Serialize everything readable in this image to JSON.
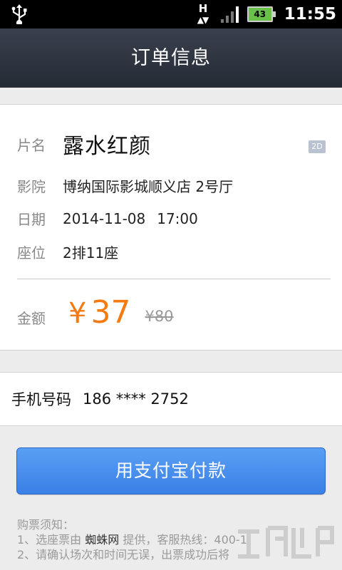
{
  "status_bar": {
    "icons": [
      "usb-icon",
      "hspa-data-icon",
      "signal-icon",
      "battery-icon"
    ],
    "network": "H",
    "battery_level": "43",
    "time": "11:55"
  },
  "header": {
    "title": "订单信息"
  },
  "order": {
    "movie_label": "片名",
    "movie": "露水红颜",
    "format_badge": "2D",
    "cinema_label": "影院",
    "cinema": "博纳国际影城顺义店 2号厅",
    "date_label": "日期",
    "date": "2014-11-08",
    "time": "17:00",
    "seat_label": "座位",
    "seat": "2排11座",
    "amount_label": "金额",
    "currency": "¥",
    "price": "37",
    "original_price": "¥80"
  },
  "phone": {
    "label": "手机号码",
    "number": "186 **** 2752"
  },
  "pay_button": {
    "label": "用支付宝付款"
  },
  "notes": {
    "title": "购票须知：",
    "line1_prefix": "1、选座票由",
    "line1_brand": "蜘蛛网",
    "line1_suffix": "提供，客服热线：400-1",
    "line2": "2、请确认场次和时间无误，出票成功后将"
  },
  "colors": {
    "title_bar": "#2f3641",
    "price": "#f47a12",
    "pay_button": "#4a90ee",
    "battery": "#6ac14a"
  }
}
